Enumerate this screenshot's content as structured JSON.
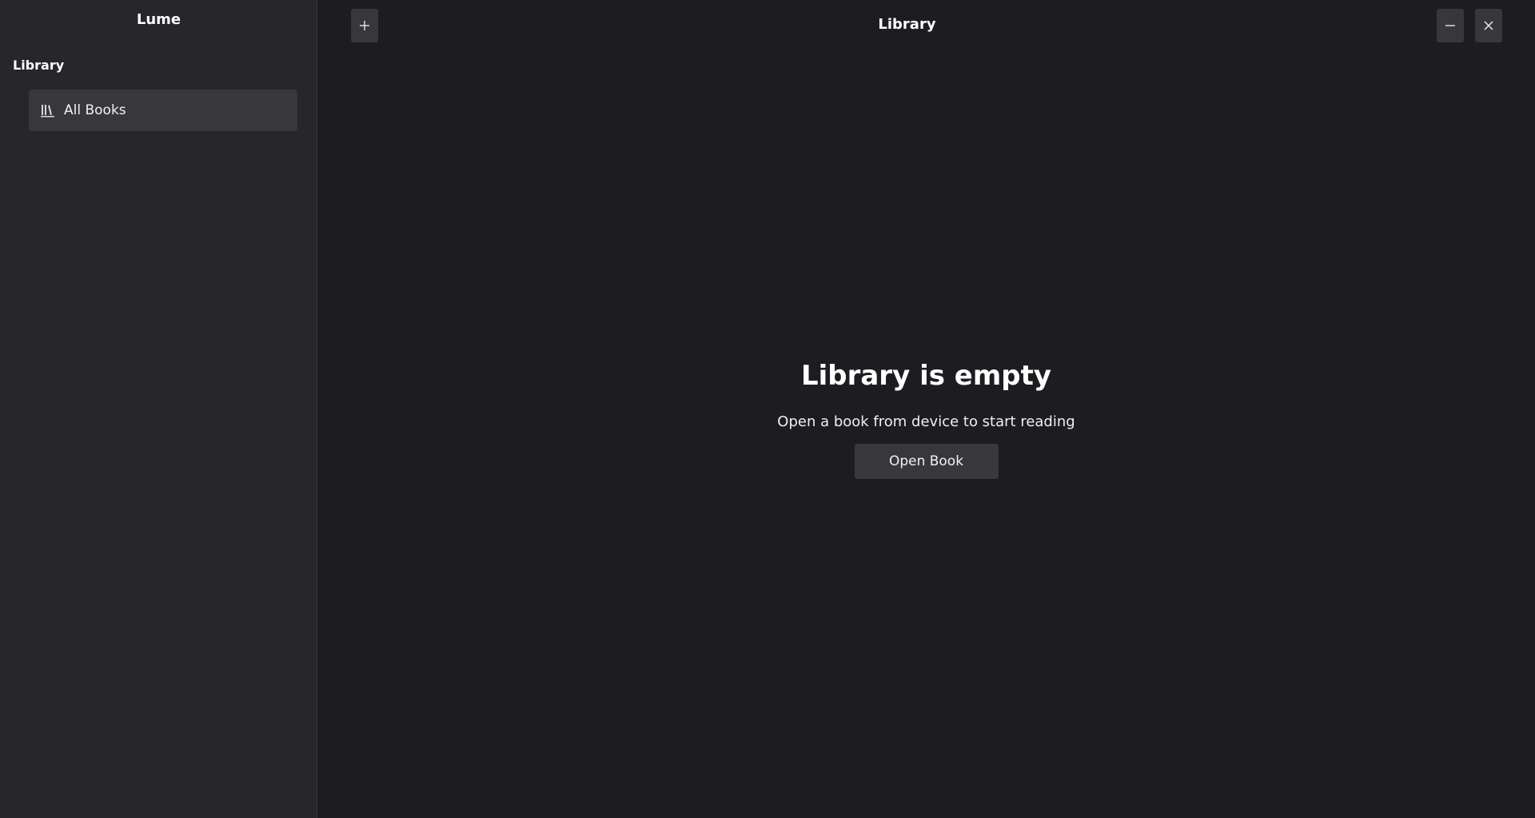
{
  "sidebar": {
    "app_title": "Lume",
    "section_label": "Library",
    "items": [
      {
        "label": "All Books",
        "icon": "library-books-icon"
      }
    ]
  },
  "header": {
    "title": "Library",
    "add_button_icon": "plus-icon",
    "minimize_button_icon": "minimize-icon",
    "close_button_icon": "close-icon"
  },
  "empty_state": {
    "title": "Library is empty",
    "subtitle": "Open a book from device to start reading",
    "button_label": "Open Book"
  },
  "colors": {
    "background": "#1d1d21",
    "sidebar": "#27272b",
    "button": "#38383c",
    "text": "#ffffff"
  }
}
